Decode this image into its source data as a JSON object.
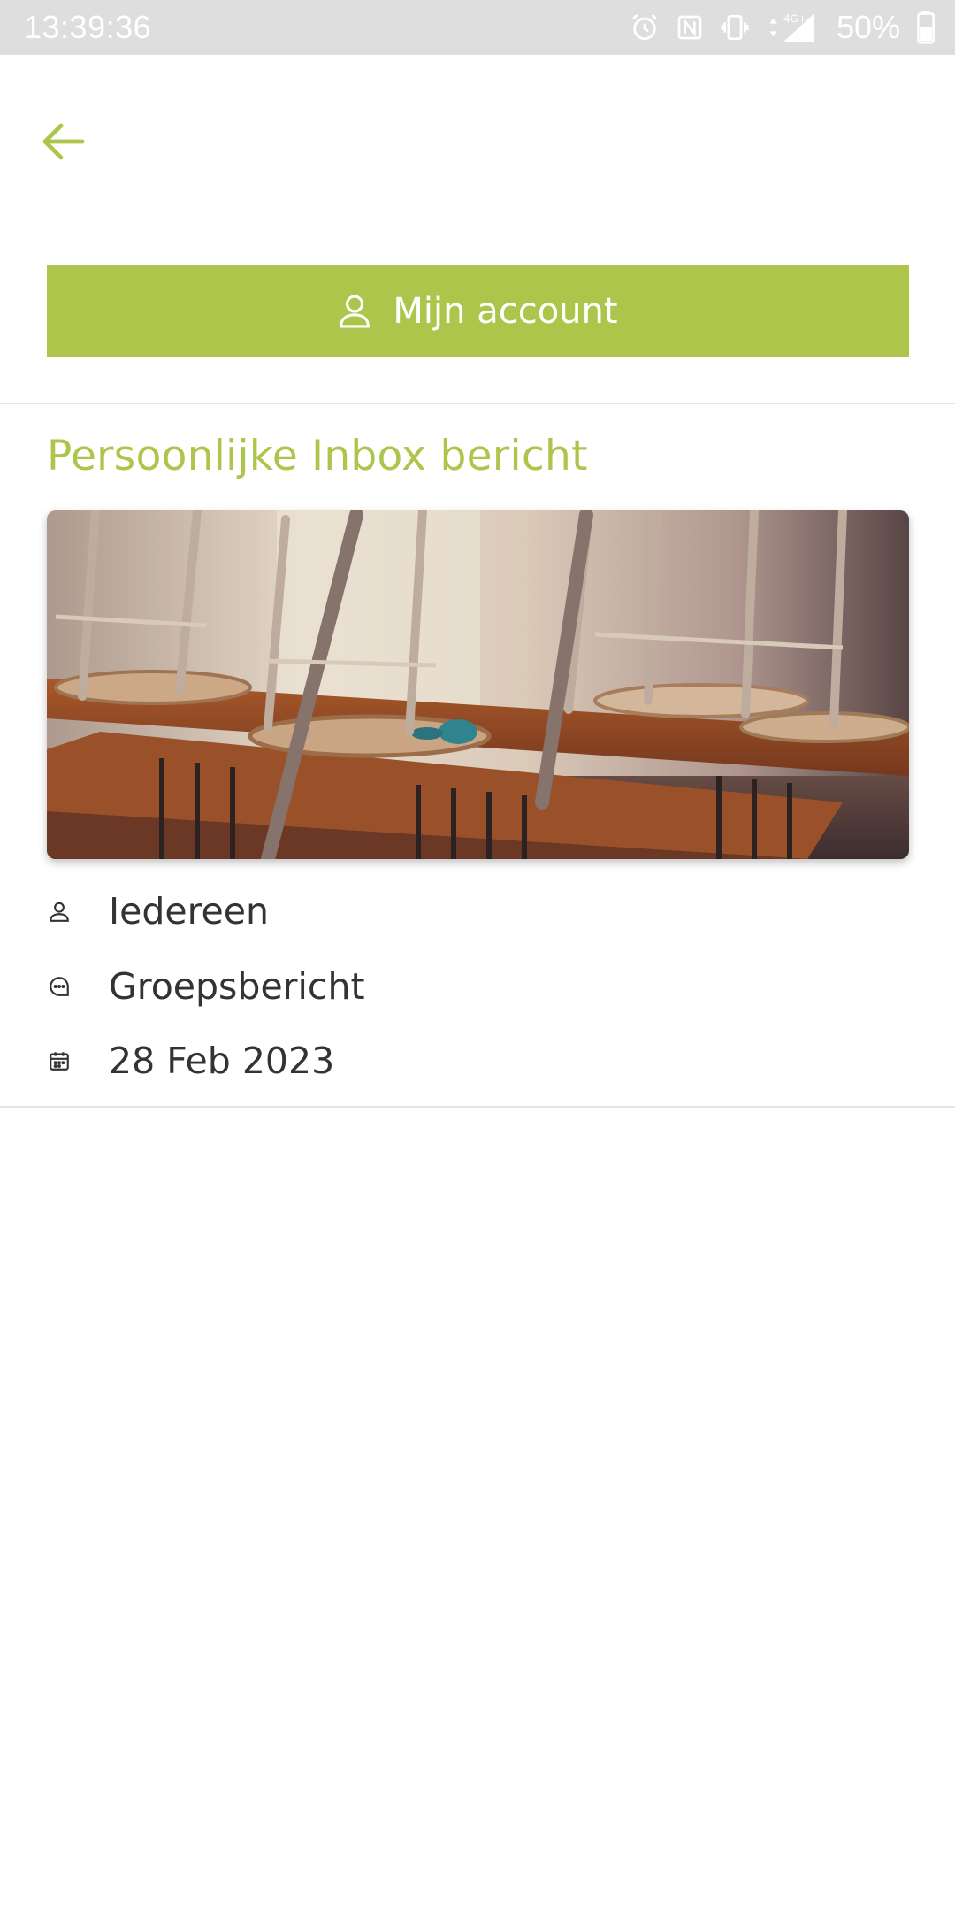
{
  "status_bar": {
    "time": "13:39:36",
    "battery": "50%",
    "network": "4G+",
    "icons": [
      "alarm-icon",
      "nfc-icon",
      "vibrate-icon",
      "signal-icon",
      "battery-icon"
    ]
  },
  "header": {
    "back_icon": "arrow-left-icon",
    "account_button_label": "Mijn account",
    "account_icon": "user-icon"
  },
  "message": {
    "title": "Persoonlijke Inbox bericht",
    "image_description_icon": "classroom-photo",
    "recipient": "Iedereen",
    "type": "Groepsbericht",
    "date": "28 Feb 2023"
  },
  "colors": {
    "accent": "#adc54a",
    "status_bar": "#dedede",
    "text": "#333333",
    "divider": "#e6e6e6"
  }
}
